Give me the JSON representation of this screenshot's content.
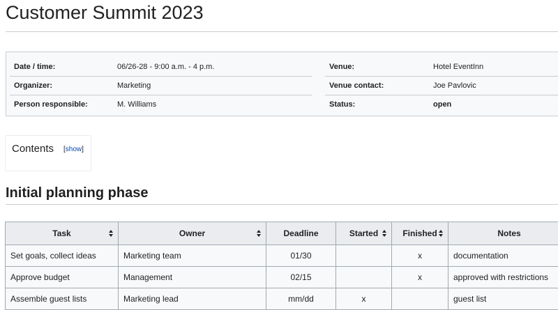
{
  "page": {
    "title": "Customer Summit 2023"
  },
  "info": {
    "left": [
      {
        "label": "Date / time:",
        "value": "06/26-28 - 9:00 a.m. - 4 p.m."
      },
      {
        "label": "Organizer:",
        "value": "Marketing"
      },
      {
        "label": "Person responsible:",
        "value": "M. Williams"
      }
    ],
    "right": [
      {
        "label": "Venue:",
        "value": "Hotel EventInn"
      },
      {
        "label": "Venue contact:",
        "value": "Joe Pavlovic"
      },
      {
        "label": "Status:",
        "value": "open"
      }
    ]
  },
  "toc": {
    "title": "Contents",
    "open_bracket": "[",
    "toggle": "show",
    "close_bracket": "]"
  },
  "section": {
    "heading": "Initial planning phase"
  },
  "table": {
    "headers": [
      "Task",
      "Owner",
      "Deadline",
      "Started",
      "Finished",
      "Notes"
    ],
    "rows": [
      [
        "Set goals, collect ideas",
        "Marketing team",
        "01/30",
        "",
        "x",
        "documentation"
      ],
      [
        "Approve budget",
        "Management",
        "02/15",
        "",
        "x",
        "approved with restrictions"
      ],
      [
        "Assemble guest lists",
        "Marketing lead",
        "mm/dd",
        "x",
        "",
        "guest list"
      ]
    ]
  }
}
